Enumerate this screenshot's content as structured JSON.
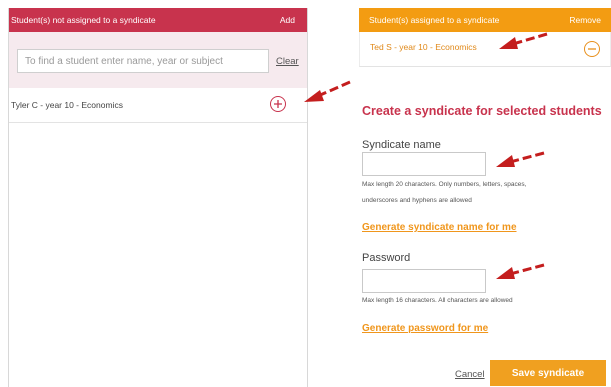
{
  "unassigned": {
    "header_title": "Student(s) not assigned to a syndicate",
    "add_label": "Add",
    "search_placeholder": "To find a student enter name, year or subject",
    "clear_label": "Clear",
    "students": [
      {
        "name": "Tyler C - year 10 - Economics"
      }
    ]
  },
  "assigned": {
    "header_title": "Student(s) assigned to a syndicate",
    "remove_label": "Remove",
    "students": [
      {
        "name": "Ted S - year 10 - Economics"
      }
    ]
  },
  "form": {
    "title": "Create a syndicate for selected students",
    "syndicate_label": "Syndicate name",
    "syndicate_help_1": "Max length 20 characters. Only numbers, letters, spaces,",
    "syndicate_help_2": "underscores and hyphens are allowed",
    "generate_syndicate_label": "Generate syndicate name for me",
    "password_label": "Password",
    "password_help": "Max length 16 characters. All characters are allowed",
    "generate_password_label": "Generate password for me",
    "cancel_label": "Cancel",
    "save_label": "Save syndicate"
  },
  "colors": {
    "unassigned_header": "#c8334d",
    "assigned_header": "#f39c12",
    "arrow": "#c41e1e",
    "accent_link": "#f0961c"
  },
  "icons": {
    "add": "plus-circle-icon",
    "remove": "minus-circle-icon",
    "annotation": "red-dashed-arrow-icon"
  }
}
